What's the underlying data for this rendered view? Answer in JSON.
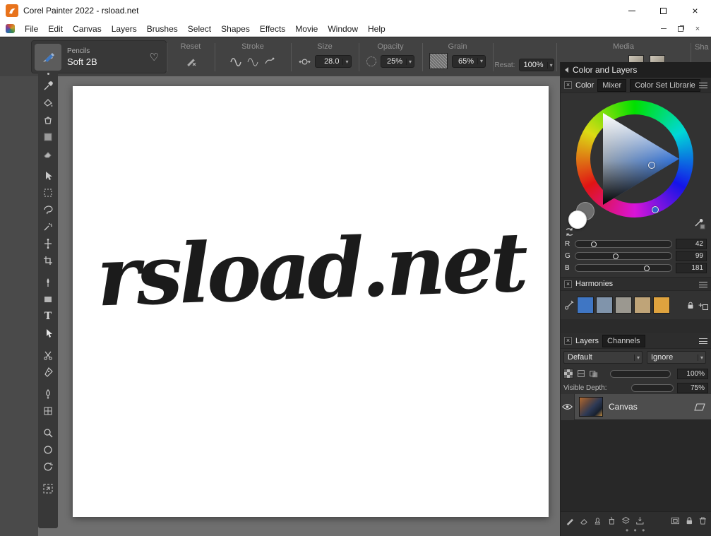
{
  "window": {
    "title": "Corel Painter 2022 - rsload.net"
  },
  "menu": {
    "items": [
      "File",
      "Edit",
      "Canvas",
      "Layers",
      "Brushes",
      "Select",
      "Shapes",
      "Effects",
      "Movie",
      "Window",
      "Help"
    ]
  },
  "property_bar": {
    "brush_category": "Pencils",
    "brush_variant": "Soft 2B",
    "reset_label": "Reset",
    "stroke_label": "Stroke",
    "size_label": "Size",
    "size_value": "28.0",
    "opacity_label": "Opacity",
    "opacity_value": "25%",
    "grain_label": "Grain",
    "grain_value": "65%",
    "resat_label": "Resat:",
    "resat_value": "100%",
    "media_label": "Media",
    "shape_label": "Sha"
  },
  "canvas": {
    "text": "rsload.net"
  },
  "right_panel": {
    "header": "Color and Layers",
    "color_tabs": [
      "Color",
      "Mixer",
      "Color Set Librarie"
    ],
    "rgb": {
      "r_label": "R",
      "r_value": "42",
      "g_label": "G",
      "g_value": "99",
      "b_label": "B",
      "b_value": "181"
    },
    "harmonies": {
      "title": "Harmonies",
      "swatches": [
        "#3f76c4",
        "#8094ab",
        "#9b9890",
        "#bfa478",
        "#dfa33e"
      ]
    },
    "layers": {
      "tabs": [
        "Layers",
        "Channels"
      ],
      "composite_method": "Default",
      "composite_depth": "Ignore",
      "opacity_value": "100%",
      "visible_depth_label": "Visible Depth:",
      "visible_depth_value": "75%",
      "rows": [
        {
          "name": "Canvas"
        }
      ]
    }
  },
  "icons": {
    "close": "×",
    "heart": "♡",
    "dropdown": "▾",
    "text_tool": "T",
    "toggle_x": "×",
    "plus": "+",
    "ellipsis": "• • •"
  },
  "colors": {
    "selected_color": "#2f66c9",
    "canvas_ink": "#1b1b1b"
  }
}
